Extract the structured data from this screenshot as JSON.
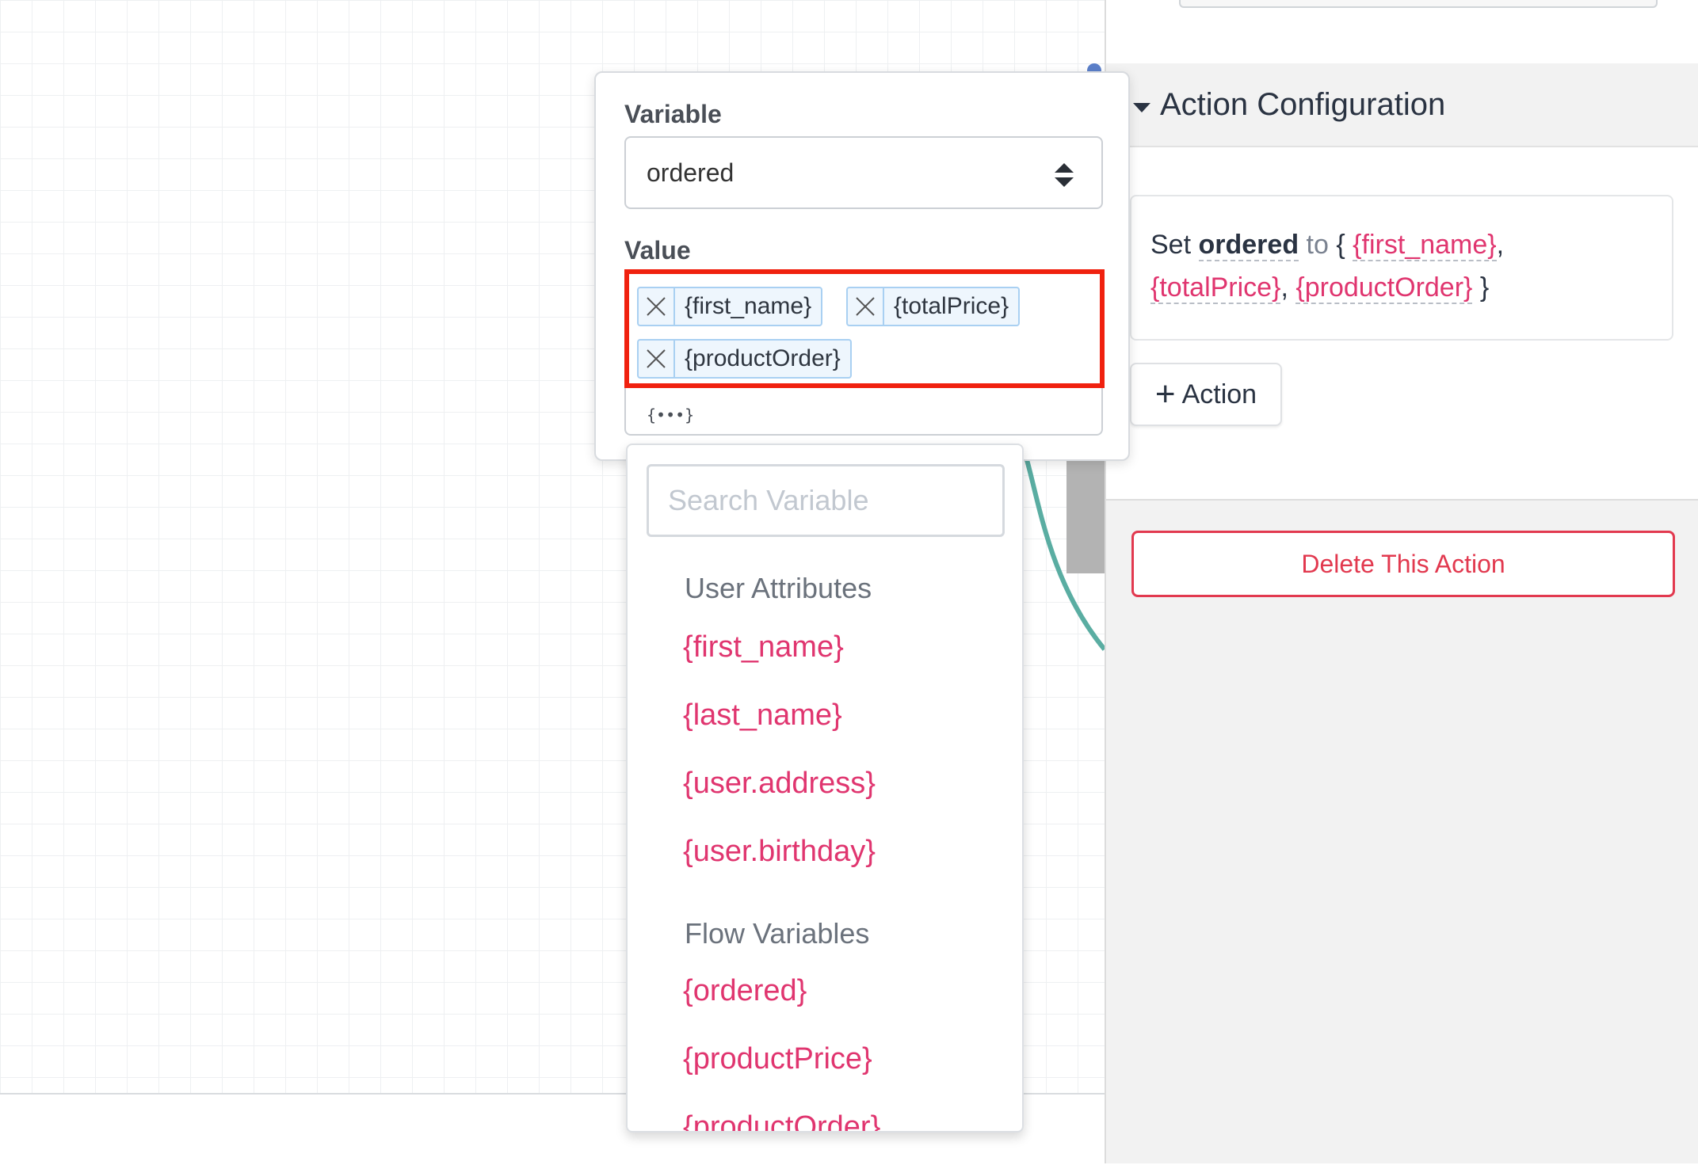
{
  "canvas": {},
  "panel": {
    "section_title": "Action Configuration",
    "summary": {
      "set_word": "Set",
      "variable": "ordered",
      "to_word": "to",
      "open_brace": "{",
      "values": [
        "{first_name}",
        "{totalPrice}",
        "{productOrder}"
      ],
      "comma": ",",
      "close_brace": "}"
    },
    "add_action_label": "Action",
    "delete_label": "Delete This Action"
  },
  "popover": {
    "variable_label": "Variable",
    "variable_value": "ordered",
    "value_label": "Value",
    "chips": [
      "{first_name}",
      "{totalPrice}",
      "{productOrder}"
    ],
    "var_toggle": "{•••}"
  },
  "dropdown": {
    "search_placeholder": "Search Variable",
    "groups": [
      {
        "title": "User Attributes",
        "items": [
          "{first_name}",
          "{last_name}",
          "{user.address}",
          "{user.birthday}"
        ]
      },
      {
        "title": "Flow Variables",
        "items": [
          "{ordered}",
          "{productPrice}",
          "{productOrder}"
        ]
      }
    ]
  },
  "colors": {
    "accent_pink": "#e0356f",
    "danger_red": "#e2394f",
    "highlight_red": "#f0210f",
    "chip_blue": "#a9d0f2",
    "connector_teal": "#5aada2"
  },
  "icons": {
    "chip_remove": "close-icon",
    "select": "sort-arrows-icon",
    "section_toggle": "caret-down-icon",
    "add": "plus-icon"
  }
}
